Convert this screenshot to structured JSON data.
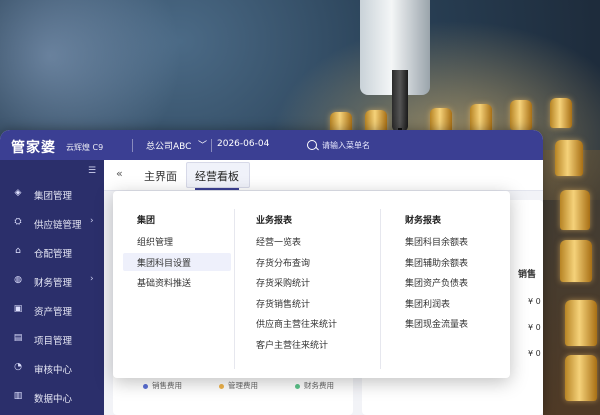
{
  "header": {
    "logo": "管家婆",
    "logo_sub": "云辉煌 C9",
    "company": "总公司ABC",
    "date": "2026-06-04",
    "search_placeholder": "请输入菜单名"
  },
  "sidebar": {
    "items": [
      {
        "label": "集团管理",
        "icon": "cube-icon",
        "has_arrow": false
      },
      {
        "label": "供应链管理",
        "icon": "network-icon",
        "has_arrow": true
      },
      {
        "label": "仓配管理",
        "icon": "warehouse-icon",
        "has_arrow": false
      },
      {
        "label": "财务管理",
        "icon": "money-bag-icon",
        "has_arrow": true
      },
      {
        "label": "资产管理",
        "icon": "asset-icon",
        "has_arrow": false
      },
      {
        "label": "项目管理",
        "icon": "project-icon",
        "has_arrow": false
      },
      {
        "label": "审核中心",
        "icon": "audit-icon",
        "has_arrow": false
      },
      {
        "label": "数据中心",
        "icon": "data-icon",
        "has_arrow": false
      }
    ]
  },
  "tabs": {
    "back": "«",
    "items": [
      {
        "label": "主界面",
        "active": false
      },
      {
        "label": "经营看板",
        "active": true
      }
    ]
  },
  "mega_menu": {
    "columns": [
      {
        "heading": "集团",
        "links": [
          "组织管理",
          "集团科目设置",
          "基础资料推送"
        ]
      },
      {
        "heading": "业务报表",
        "links": [
          "经营一览表",
          "存货分布查询",
          "存货采购统计",
          "存货销售统计",
          "供应商主营往来统计",
          "客户主营往来统计"
        ]
      },
      {
        "heading": "财务报表",
        "links": [
          "集团科目余额表",
          "集团辅助余额表",
          "集团资产负债表",
          "集团利润表",
          "集团现金流量表"
        ]
      }
    ]
  },
  "dashboard": {
    "legend": [
      {
        "label": "销售费用",
        "color": "#5b6fd6"
      },
      {
        "label": "管理费用",
        "color": "#f0b44c"
      },
      {
        "label": "财务费用",
        "color": "#5cc48a"
      }
    ],
    "right_header": "销售",
    "right_values": [
      "¥ 0",
      "¥ 0",
      "¥ 0"
    ]
  },
  "colors": {
    "topbar": "#3b3f93",
    "sidebar": "#2b2f6b",
    "accent": "#3b3f93"
  }
}
